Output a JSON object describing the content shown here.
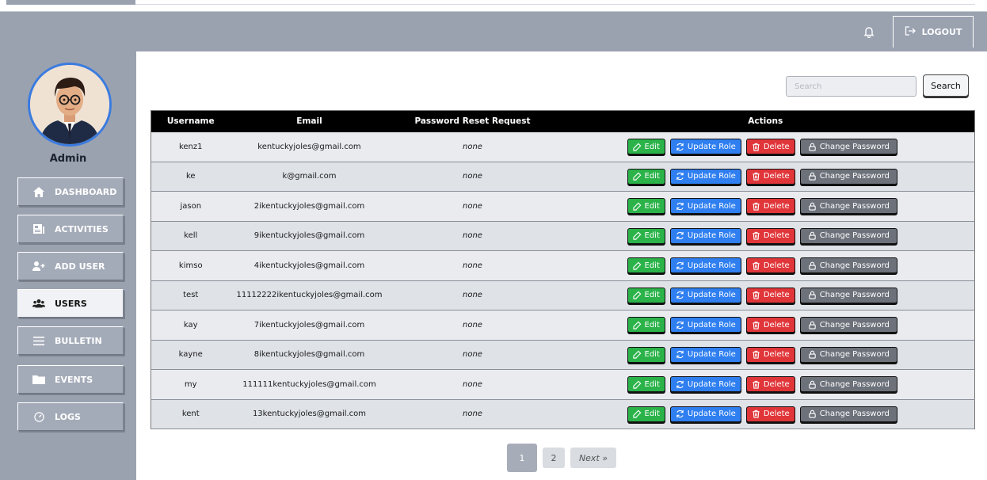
{
  "header": {
    "logout_label": "LOGOUT"
  },
  "sidebar": {
    "user_label": "Admin",
    "items": [
      {
        "label": "DASHBOARD",
        "icon": "home-icon"
      },
      {
        "label": "ACTIVITIES",
        "icon": "newspaper-icon"
      },
      {
        "label": "ADD USER",
        "icon": "user-plus-icon"
      },
      {
        "label": "USERS",
        "icon": "users-icon",
        "active": true
      },
      {
        "label": "BULLETIN",
        "icon": "bars-icon"
      },
      {
        "label": "EVENTS",
        "icon": "folder-icon"
      },
      {
        "label": "LOGS",
        "icon": "gauge-icon"
      }
    ]
  },
  "search": {
    "placeholder": "Search",
    "button_label": "Search"
  },
  "table": {
    "headers": [
      "Username",
      "Email",
      "Password Reset Request",
      "Actions"
    ],
    "rows": [
      {
        "username": "kenz1",
        "email": "kentuckyjoles@gmail.com",
        "reset": "none"
      },
      {
        "username": "ke",
        "email": "k@gmail.com",
        "reset": "none"
      },
      {
        "username": "jason",
        "email": "2ikentuckyjoles@gmail.com",
        "reset": "none"
      },
      {
        "username": "kell",
        "email": "9ikentuckyjoles@gmail.com",
        "reset": "none"
      },
      {
        "username": "kimso",
        "email": "4ikentuckyjoles@gmail.com",
        "reset": "none"
      },
      {
        "username": "test",
        "email": "11112222ikentuckyjoles@gmail.com",
        "reset": "none"
      },
      {
        "username": "kay",
        "email": "7ikentuckyjoles@gmail.com",
        "reset": "none"
      },
      {
        "username": "kayne",
        "email": "8ikentuckyjoles@gmail.com",
        "reset": "none"
      },
      {
        "username": "my",
        "email": "111111kentuckyjoles@gmail.com",
        "reset": "none"
      },
      {
        "username": "kent",
        "email": "13kentuckyjoles@gmail.com",
        "reset": "none"
      }
    ],
    "action_labels": {
      "edit": "Edit",
      "update_role": "Update Role",
      "delete": "Delete",
      "change_password": "Change Password"
    }
  },
  "pagination": {
    "pages": [
      "1",
      "2"
    ],
    "current": "1",
    "next_label": "Next »"
  },
  "colors": {
    "background": "#9aa2b0",
    "edit": "#2bb34a",
    "update_role": "#2f7ff0",
    "delete": "#e0363a",
    "change_password": "#6c717a",
    "avatar_ring": "#3a7be0"
  }
}
